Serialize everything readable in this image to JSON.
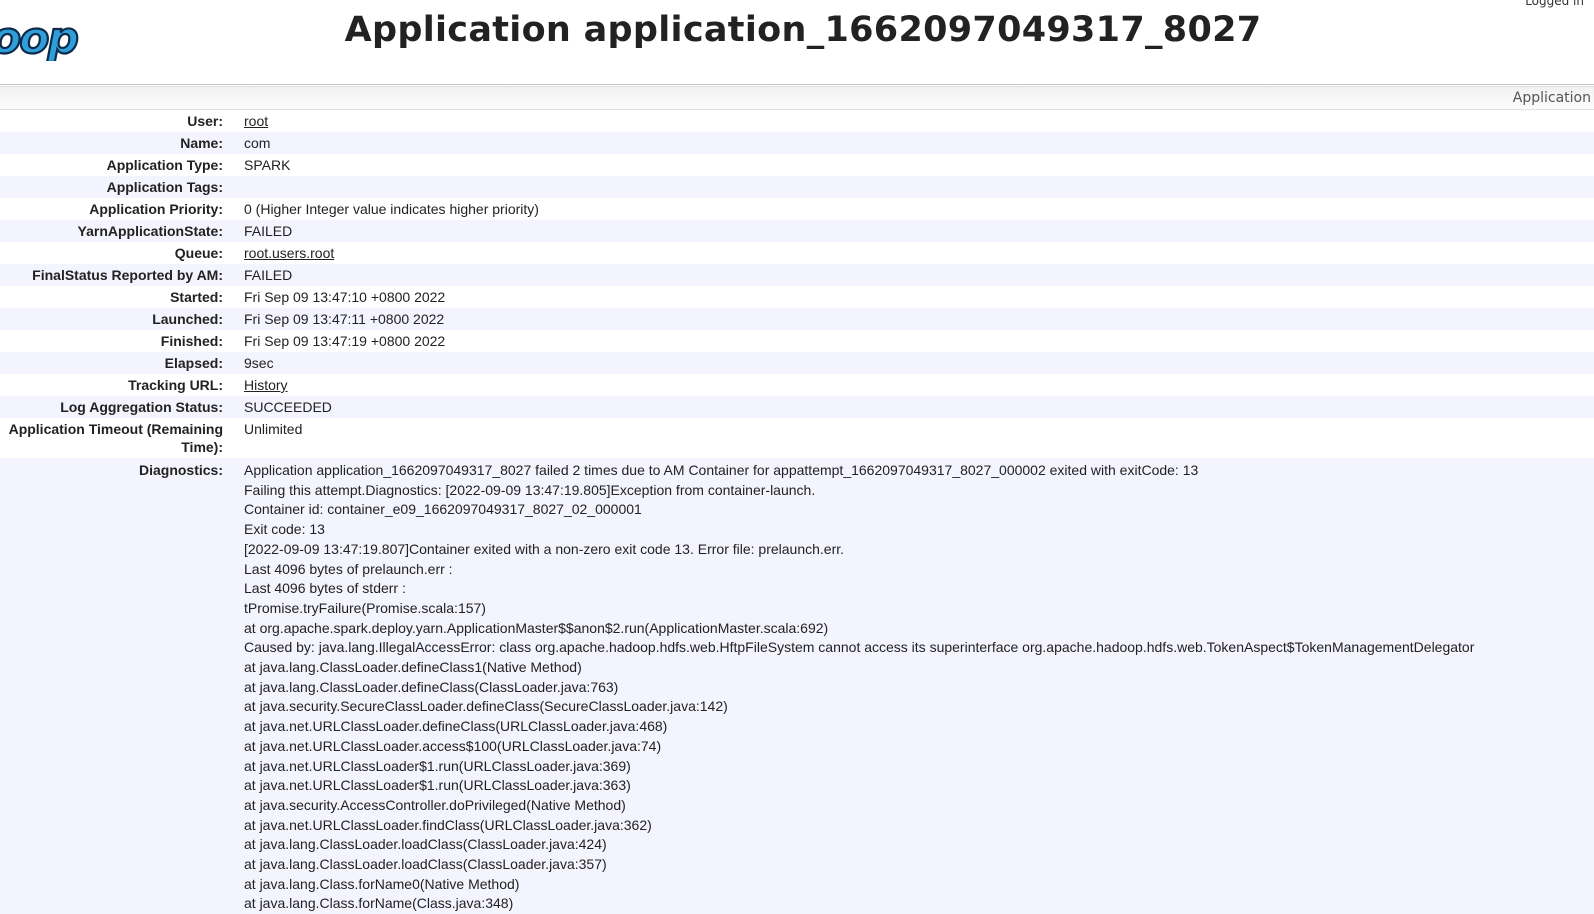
{
  "header": {
    "logo_text": "oop",
    "logged_in": "Logged in",
    "title": "Application application_1662097049317_8027"
  },
  "nav": {
    "crumb": "Application"
  },
  "overview": [
    {
      "label": "User:",
      "value": "root",
      "link": true
    },
    {
      "label": "Name:",
      "value": "com",
      "link": false
    },
    {
      "label": "Application Type:",
      "value": "SPARK",
      "link": false
    },
    {
      "label": "Application Tags:",
      "value": "",
      "link": false
    },
    {
      "label": "Application Priority:",
      "value": "0 (Higher Integer value indicates higher priority)",
      "link": false
    },
    {
      "label": "YarnApplicationState:",
      "value": "FAILED",
      "link": false
    },
    {
      "label": "Queue:",
      "value": "root.users.root",
      "link": true
    },
    {
      "label": "FinalStatus Reported by AM:",
      "value": "FAILED",
      "link": false
    },
    {
      "label": "Started:",
      "value": "Fri Sep 09 13:47:10 +0800 2022",
      "link": false
    },
    {
      "label": "Launched:",
      "value": "Fri Sep 09 13:47:11 +0800 2022",
      "link": false
    },
    {
      "label": "Finished:",
      "value": "Fri Sep 09 13:47:19 +0800 2022",
      "link": false
    },
    {
      "label": "Elapsed:",
      "value": "9sec",
      "link": false
    },
    {
      "label": "Tracking URL:",
      "value": "History",
      "link": true
    },
    {
      "label": "Log Aggregation Status:",
      "value": "SUCCEEDED",
      "link": false
    },
    {
      "label": "Application Timeout (Remaining Time):",
      "value": "Unlimited",
      "link": false
    }
  ],
  "diagnostics": {
    "label": "Diagnostics:",
    "lines": [
      "Application application_1662097049317_8027 failed 2 times due to AM Container for appattempt_1662097049317_8027_000002 exited with exitCode: 13",
      "Failing this attempt.Diagnostics: [2022-09-09 13:47:19.805]Exception from container-launch.",
      "Container id: container_e09_1662097049317_8027_02_000001",
      "Exit code: 13",
      "[2022-09-09 13:47:19.807]Container exited with a non-zero exit code 13. Error file: prelaunch.err.",
      "Last 4096 bytes of prelaunch.err :",
      "Last 4096 bytes of stderr :",
      "tPromise.tryFailure(Promise.scala:157)",
      "at org.apache.spark.deploy.yarn.ApplicationMaster$$anon$2.run(ApplicationMaster.scala:692)",
      "Caused by: java.lang.IllegalAccessError: class org.apache.hadoop.hdfs.web.HftpFileSystem cannot access its superinterface org.apache.hadoop.hdfs.web.TokenAspect$TokenManagementDelegator",
      "at java.lang.ClassLoader.defineClass1(Native Method)",
      "at java.lang.ClassLoader.defineClass(ClassLoader.java:763)",
      "at java.security.SecureClassLoader.defineClass(SecureClassLoader.java:142)",
      "at java.net.URLClassLoader.defineClass(URLClassLoader.java:468)",
      "at java.net.URLClassLoader.access$100(URLClassLoader.java:74)",
      "at java.net.URLClassLoader$1.run(URLClassLoader.java:369)",
      "at java.net.URLClassLoader$1.run(URLClassLoader.java:363)",
      "at java.security.AccessController.doPrivileged(Native Method)",
      "at java.net.URLClassLoader.findClass(URLClassLoader.java:362)",
      "at java.lang.ClassLoader.loadClass(ClassLoader.java:424)",
      "at java.lang.ClassLoader.loadClass(ClassLoader.java:357)",
      "at java.lang.Class.forName0(Native Method)",
      "at java.lang.Class.forName(Class.java:348)"
    ]
  },
  "colors": {
    "logo_blue": "#2e9fd8",
    "stripe": "#f4f4ff"
  }
}
